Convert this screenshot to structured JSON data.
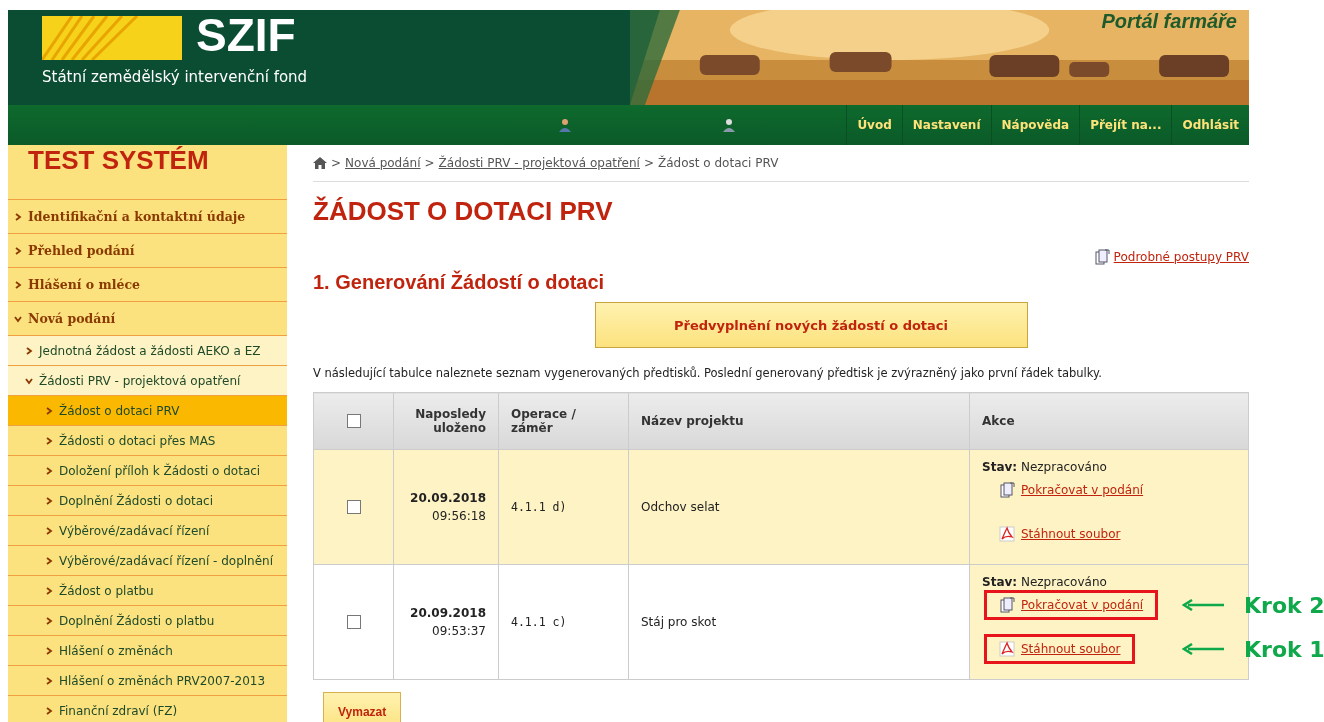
{
  "header": {
    "org_name": "SZIF",
    "org_subtitle": "Státní zemědělský intervenční fond",
    "portal_title": "Portál farmáře",
    "nav": [
      {
        "label": "Úvod"
      },
      {
        "label": "Nastavení"
      },
      {
        "label": "Nápověda"
      },
      {
        "label": "Přejít na..."
      },
      {
        "label": "Odhlásit"
      }
    ]
  },
  "sidebar": {
    "title": "TEST SYSTÉM",
    "items": [
      {
        "label": "Identifikační a kontaktní údaje",
        "expanded": false,
        "selected": false
      },
      {
        "label": "Přehled podání",
        "expanded": false,
        "selected": false
      },
      {
        "label": "Hlášení o mléce",
        "expanded": false,
        "selected": false
      },
      {
        "label": "Nová podání",
        "expanded": true,
        "selected": false,
        "children": [
          {
            "label": "Jednotná žádost a žádosti AEKO a EZ",
            "expanded": false,
            "selected": false
          },
          {
            "label": "Žádosti PRV - projektová opatření",
            "expanded": true,
            "selected": false,
            "children": [
              {
                "label": "Žádost o dotaci PRV",
                "selected": true
              },
              {
                "label": "Žádosti o dotaci přes MAS",
                "selected": false
              },
              {
                "label": "Doložení příloh k Žádosti o dotaci",
                "selected": false
              },
              {
                "label": "Doplnění Žádosti o dotaci",
                "selected": false
              },
              {
                "label": "Výběrové/zadávací řízení",
                "selected": false
              },
              {
                "label": "Výběrové/zadávací řízení - doplnění",
                "selected": false
              },
              {
                "label": "Žádost o platbu",
                "selected": false
              },
              {
                "label": "Doplnění Žádosti o platbu",
                "selected": false
              },
              {
                "label": "Hlášení o změnách",
                "selected": false
              },
              {
                "label": "Hlášení o změnách PRV2007-2013",
                "selected": false
              },
              {
                "label": "Finanční zdraví (FZ)",
                "selected": false
              }
            ]
          }
        ]
      }
    ]
  },
  "breadcrumb": [
    {
      "separator": ">",
      "label": "Nová podání",
      "link": true
    },
    {
      "separator": ">",
      "label": "Žádosti PRV - projektová opatření",
      "link": true
    },
    {
      "separator": ">",
      "label": "Žádost o dotaci PRV",
      "link": false
    }
  ],
  "page_title": "ŽÁDOST O DOTACI PRV",
  "procedures_link": "Podrobné postupy PRV",
  "section_title": "1. Generování Žádostí o dotaci",
  "prefill_button": "Předvyplnění nových žádostí o dotaci",
  "intro": "V následující tabulce naleznete seznam vygenerovaných předtisků. Poslední generovaný předtisk je zvýrazněný jako první řádek tabulky.",
  "table": {
    "header_checked": false,
    "columns": [
      "Naposledy uloženo",
      "Operace / záměr",
      "Název projektu",
      "Akce"
    ],
    "rows": [
      {
        "checked": false,
        "highlighted": true,
        "date": "20.09.2018",
        "time": "09:56:18",
        "operation": "4.1.1 d)",
        "name": "Odchov selat",
        "status_label": "Stav:",
        "status": "Nezpracováno",
        "actions": [
          {
            "kind": "continue",
            "label": "Pokračovat v podání"
          },
          {
            "kind": "download",
            "label": "Stáhnout soubor"
          }
        ]
      },
      {
        "checked": false,
        "highlighted": false,
        "date": "20.09.2018",
        "time": "09:53:37",
        "operation": "4.1.1 c)",
        "name": "Stáj pro skot",
        "status_label": "Stav:",
        "status": "Nezpracováno",
        "actions": [
          {
            "kind": "continue",
            "label": "Pokračovat v podání",
            "callout": "Krok 2"
          },
          {
            "kind": "download",
            "label": "Stáhnout soubor",
            "callout": "Krok 1"
          }
        ]
      }
    ]
  },
  "delete_button": "Vymazat"
}
